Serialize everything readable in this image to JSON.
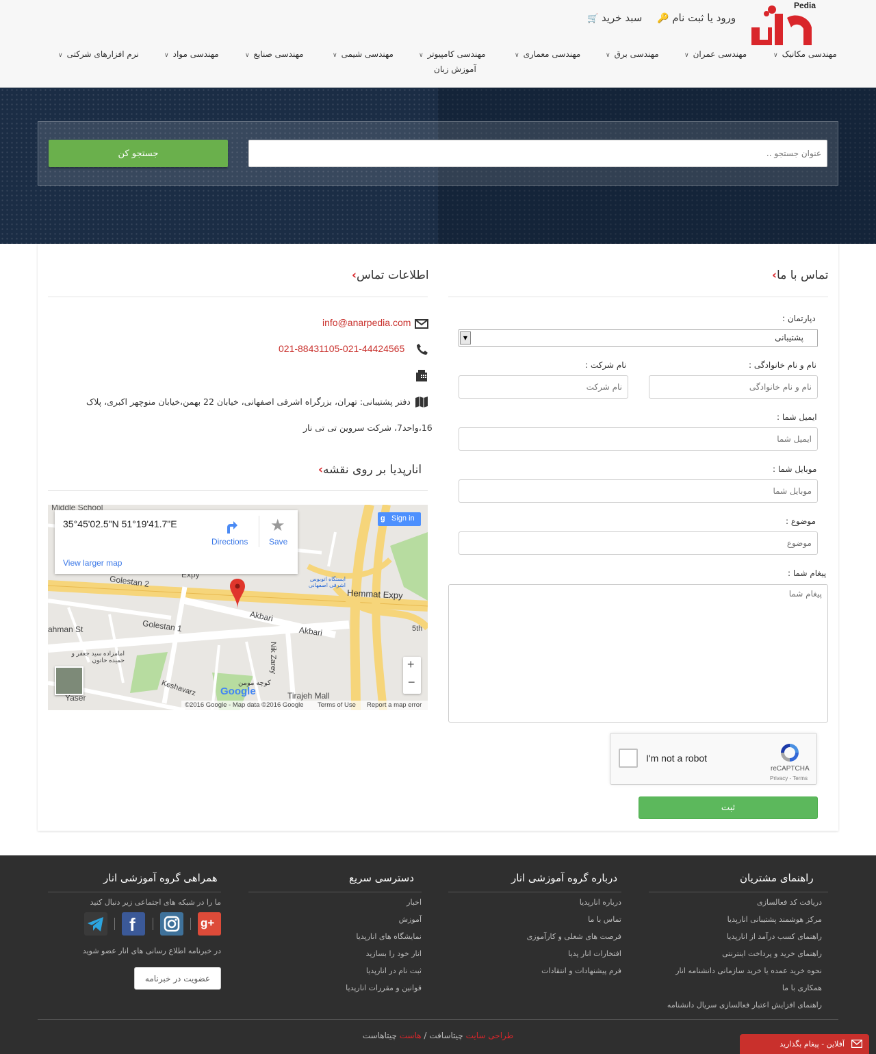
{
  "header": {
    "logo_text": "Pedia",
    "login_label": "ورود یا ثبت نام",
    "cart_label": "سبد خرید",
    "nav": [
      "مهندسی مکانیک",
      "مهندسی عمران",
      "مهندسی برق",
      "مهندسی معماری",
      "مهندسی کامپیوتر",
      "مهندسی شیمی",
      "مهندسی صنایع",
      "مهندسی مواد",
      "نرم افزارهای شرکتی",
      "آموزش زبان"
    ]
  },
  "search": {
    "placeholder": "عنوان جستجو ..",
    "button_label": "جستجو کن"
  },
  "contact_form": {
    "title": "تماس با ما",
    "department_label": "دپارتمان :",
    "department_value": "پشتیبانی",
    "name_label": "نام و نام خانوادگی :",
    "name_placeholder": "نام و نام خانوادگی",
    "company_label": "نام شرکت :",
    "company_placeholder": "نام شرکت",
    "email_label": "ایمیل شما :",
    "email_placeholder": "ایمیل شما",
    "mobile_label": "موبایل شما :",
    "mobile_placeholder": "موبایل شما",
    "subject_label": "موضوع :",
    "subject_placeholder": "موضوع",
    "message_label": "پیغام شما :",
    "message_placeholder": "پیغام شما",
    "captcha_text": "I'm not a robot",
    "captcha_brand": "reCAPTCHA",
    "captcha_terms": "Privacy - Terms",
    "submit_label": "ثبت"
  },
  "contact_info": {
    "title": "اطلاعات تماس",
    "email": "info@anarpedia.com",
    "phones": "021-88431105-021-44424565",
    "address_line1": "دفتر پشتیبانی: تهران، بزرگراه اشرفی اصفهانی، خیابان 22 بهمن،خیابان منوچهر اکبری، پلاک",
    "address_line2": "16،واحد7، شرکت سروین تی تی نار"
  },
  "map_section": {
    "title": "انارپدیا بر روی نقشه",
    "coords": "35°45'02.5\"N 51°19'41.7\"E",
    "directions_label": "Directions",
    "save_label": "Save",
    "view_larger": "View larger map",
    "sign_in": "Sign in",
    "roads": {
      "hemmat": "Hemmat Expy",
      "expy": "Expy",
      "akbari1": "Akbari",
      "akbari2": "Akbari",
      "golestan2": "Golestan 2",
      "golestan1": "Golestan 1",
      "nikzarey": "Nik Zarey",
      "tirajeh": "Tirajeh Mall",
      "yaser": "Yaser",
      "keshavarz": "Keshavarz",
      "middle_school": "Middle School",
      "rahman": "ahman St",
      "fifth": "5th",
      "bus_station": "ایستگاه اتوبوس اشرفی اصفهانی",
      "mosque": "کوچه مومن",
      "imamzadeh": "امامزاده سید جعفر و حمیده خاتون"
    },
    "copyright": "©2016 Google - Map data ©2016 Google",
    "terms": "Terms of Use",
    "report": "Report a map error",
    "google": "Google"
  },
  "footer": {
    "col1": {
      "title": "راهنمای مشتریان",
      "links": [
        "دریافت کد فعالسازی",
        "مرکز هوشمند پشتیبانی انارپدیا",
        "راهنمای کسب درآمد از انارپدیا",
        "راهنمای خرید و پرداخت اینترنتی",
        "نحوه خرید عمده یا خرید سازمانی دانشنامه انار",
        "همکاری با ما",
        "راهنمای افزایش اعتبار فعالسازی سریال دانشنامه"
      ]
    },
    "col2": {
      "title": "درباره گروه آموزشی انار",
      "links": [
        "درباره انارپدیا",
        "تماس با ما",
        "فرصت های شغلی و کارآموزی",
        "افتخارات انار پدیا",
        "فرم پیشنهادات و انتقادات"
      ]
    },
    "col3": {
      "title": "دسترسی سریع",
      "links": [
        "اخبار",
        "آموزش",
        "نمایشگاه های انارپدیا",
        "انار خود را بسازید",
        "ثبت نام در انارپدیا",
        "قوانین و مقررات انارپدیا"
      ]
    },
    "col4": {
      "title": "همراهی گروه آموزشی انار",
      "social_text": "ما را در شبکه های اجتماعی زیر دنبال کنید",
      "newsletter_text": "در خبرنامه اطلاع رسانی های انار عضو شوید",
      "newsletter_button": "عضویت در خبرنامه"
    },
    "copyright_red1": "طراحی سایت",
    "copyright_mid": "چیتاسافت /",
    "copyright_red2": "هاست",
    "copyright_end": "چیتاهاست",
    "chat": "آفلاین - پیغام بگذارید"
  },
  "colors": {
    "brand_red": "#d9262b",
    "search_green": "#6ab04c",
    "submit_green": "#5cb85c",
    "footer_bg": "#2f2f2f",
    "hero_bg": "#1b2d45"
  }
}
